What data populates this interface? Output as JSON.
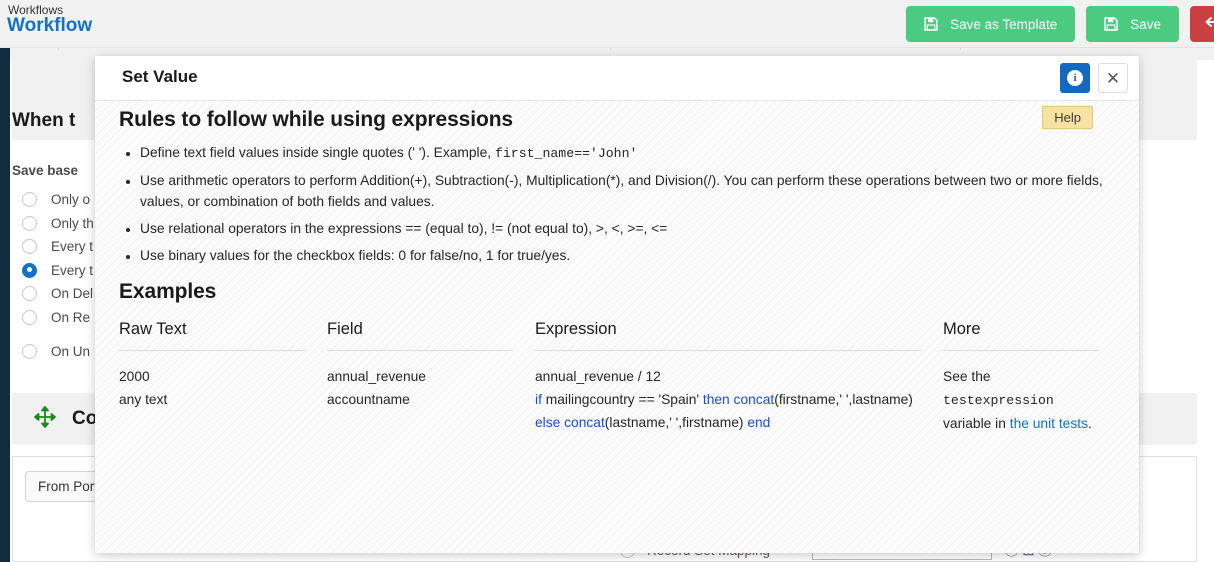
{
  "header": {
    "breadcrumb": "Workflows",
    "title": "Workflow",
    "buttons": {
      "save_as_template": "Save as Template",
      "save": "Save",
      "undo_icon": "undo-arrow-icon"
    }
  },
  "background": {
    "when_card_title": "When t",
    "save_based_label": "Save base",
    "radio_options": [
      {
        "label": "Only o",
        "selected": false
      },
      {
        "label": "Only th",
        "selected": false
      },
      {
        "label": "Every t",
        "selected": false
      },
      {
        "label": "Every t",
        "selected": true
      },
      {
        "label": "On Del",
        "selected": false
      },
      {
        "label": "On Re",
        "selected": false
      },
      {
        "label": "On Un",
        "selected": false
      }
    ],
    "connect_card_title": "Co",
    "connect_icon": "move-arrows-icon",
    "from_port": "From Port",
    "record_set_mapping_label": "Record Set Mapping",
    "mini_icons": [
      "info-circle-icon",
      "plus-box-icon",
      "collapse-circle-icon"
    ]
  },
  "modal": {
    "title": "Set Value",
    "info_button_icon": "info-icon",
    "info_button_label": "i",
    "close_button_icon": "close-icon",
    "close_button_label": "✕",
    "tooltip": "Help",
    "rules_heading": "Rules to follow while using expressions",
    "rules": [
      {
        "pre": "Define text field values inside single quotes (' '). Example, ",
        "code": "first_name=='John'",
        "post": ""
      },
      {
        "pre": "Use arithmetic operators to perform Addition(+), Subtraction(-), Multiplication(*), and Division(/). You can perform these operations between two or more fields, values, or combination of both fields and values.",
        "code": "",
        "post": ""
      },
      {
        "pre": "Use relational operators in the expressions == (equal to), != (not equal to), >, <, >=, <=",
        "code": "",
        "post": ""
      },
      {
        "pre": "Use binary values for the checkbox fields: 0 for false/no, 1 for true/yes.",
        "code": "",
        "post": ""
      }
    ],
    "examples_heading": "Examples",
    "examples": {
      "columns": [
        "Raw Text",
        "Field",
        "Expression",
        "More"
      ],
      "raw_text": [
        "2000",
        "any text"
      ],
      "field": [
        "annual_revenue",
        "accountname"
      ],
      "expression": {
        "line1": "annual_revenue / 12",
        "line2_parts": [
          {
            "t": "if",
            "kw": true
          },
          {
            "t": " mailingcountry == 'Spain' ",
            "kw": false
          },
          {
            "t": "then concat",
            "kw": true
          },
          {
            "t": "(firstname,' ',lastname) ",
            "kw": false
          },
          {
            "t": "else concat",
            "kw": true
          },
          {
            "t": "(lastname,' ',firstname) ",
            "kw": false
          },
          {
            "t": "end",
            "kw": true
          }
        ]
      },
      "more": {
        "pre": "See the ",
        "mono": "testexpression",
        "mid": " variable in ",
        "link": "the unit tests",
        "post": "."
      }
    }
  }
}
